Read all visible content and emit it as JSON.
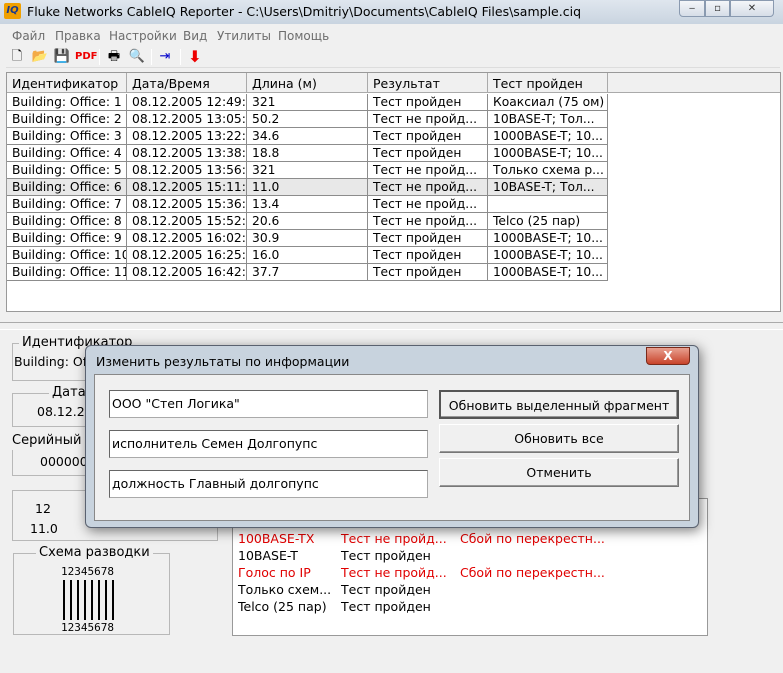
{
  "window": {
    "title": "Fluke Networks CableIQ Reporter - C:\\Users\\Dmitriy\\Documents\\CableIQ Files\\sample.ciq",
    "icon_text": "IQ"
  },
  "menu": [
    "Файл",
    "Правка",
    "Настройки",
    "Вид",
    "Утилиты",
    "Помощь"
  ],
  "toolbar": [
    "new-file-icon",
    "open-folder-icon",
    "save-icon",
    "pdf-icon",
    "print-icon",
    "print-preview-icon",
    "export-icon",
    "download-arrow-icon"
  ],
  "table": {
    "headers": [
      "Идентификатор",
      "Дата/Время",
      "Длина (м)",
      "Результат",
      "Тест пройден"
    ],
    "rows": [
      [
        "Building: Office: 1",
        "08.12.2005 12:49:...",
        "321",
        "Тест пройден",
        "Коаксиал (75 ом)"
      ],
      [
        "Building: Office: 2",
        "08.12.2005 13:05:...",
        "50.2",
        "Тест не пройд...",
        "10BASE-T; Тол..."
      ],
      [
        "Building: Office: 3",
        "08.12.2005 13:22:...",
        "34.6",
        "Тест пройден",
        "1000BASE-T; 10..."
      ],
      [
        "Building: Office: 4",
        "08.12.2005 13:38:...",
        "18.8",
        "Тест пройден",
        "1000BASE-T; 10..."
      ],
      [
        "Building: Office: 5",
        "08.12.2005 13:56:...",
        "321",
        "Тест не пройд...",
        "Только схема р..."
      ],
      [
        "Building: Office: 6",
        "08.12.2005 15:11:...",
        "11.0",
        "Тест не пройд...",
        "10BASE-T; Тол..."
      ],
      [
        "Building: Office: 7",
        "08.12.2005 15:36:...",
        "13.4",
        "Тест не пройд...",
        ""
      ],
      [
        "Building: Office: 8",
        "08.12.2005 15:52:...",
        "20.6",
        "Тест не пройд...",
        "Telco (25 пар)"
      ],
      [
        "Building: Office: 9",
        "08.12.2005 16:02:...",
        "30.9",
        "Тест пройден",
        "1000BASE-T; 10..."
      ],
      [
        "Building: Office: 10",
        "08.12.2005 16:25:...",
        "16.0",
        "Тест пройден",
        "1000BASE-T; 10..."
      ],
      [
        "Building: Office: 11",
        "08.12.2005 16:42:...",
        "37.7",
        "Тест пройден",
        "1000BASE-T; 10..."
      ]
    ],
    "selected_row": 5
  },
  "details": {
    "id_label": "Идентификатор",
    "id_value": "Building: Of",
    "date_label": "Дата",
    "date_value": "08.12.20",
    "serial_label": "Серийный н",
    "serial_value": "0000000",
    "pairs_top": "12",
    "pairs_value": "11.0",
    "wiremap_label": "Схема разводки",
    "wiremap_pins": "12345678"
  },
  "results_list": [
    {
      "test": "100BASE-TX",
      "result": "Тест не пройд...",
      "reason": "Сбой по перекрестн...",
      "fail": true
    },
    {
      "test": "10BASE-T",
      "result": "Тест пройден",
      "reason": "",
      "fail": false
    },
    {
      "test": "Голос по IP",
      "result": "Тест не пройд...",
      "reason": "Сбой по перекрестн...",
      "fail": true
    },
    {
      "test": "Только схем...",
      "result": "Тест пройден",
      "reason": "",
      "fail": false
    },
    {
      "test": "Telco (25 пар)",
      "result": "Тест пройден",
      "reason": "",
      "fail": false
    }
  ],
  "dialog": {
    "title": "Изменить результаты по информации",
    "fields": [
      "ООО \"Степ Логика\"",
      "исполнитель Семен Долгопупс",
      "должность Главный долгопупс"
    ],
    "buttons": [
      "Обновить выделенный фрагмент",
      "Обновить все",
      "Отменить"
    ],
    "close": "X"
  },
  "colors": {
    "fail": "#e00000"
  }
}
